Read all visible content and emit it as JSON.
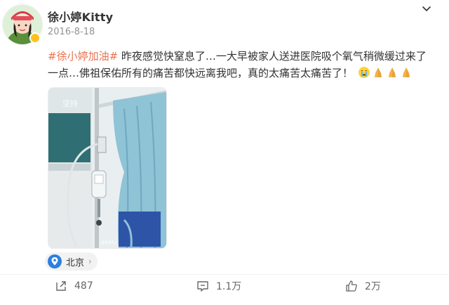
{
  "post": {
    "author": "徐小婷Kitty",
    "date": "2016-8-18",
    "hashtag": "#徐小婷加油#",
    "text_line1": " 昨夜感觉快窒息了…一大早被家人送进医院吸个氧气稍微缓过来了",
    "text_line2": "一点…佛祖保佑所有的痛苦都快远离我吧，真的太痛苦太痛苦了！",
    "photo_watermark": "@Kitty",
    "location": "北京"
  },
  "actions": {
    "reposts": "487",
    "comments": "1.1万",
    "likes": "2万"
  },
  "icons": {
    "more": "chevron-down-icon",
    "location": "location-pin-icon",
    "repost": "repost-icon",
    "comment": "comment-icon",
    "like": "thumbs-up-icon",
    "emoji_cry": "crying-face-icon",
    "emoji_pray": "praying-hands-icon"
  },
  "colors": {
    "hashtag": "#eb7350",
    "verified": "#ffc01e",
    "location_pin": "#2d7fe0"
  }
}
